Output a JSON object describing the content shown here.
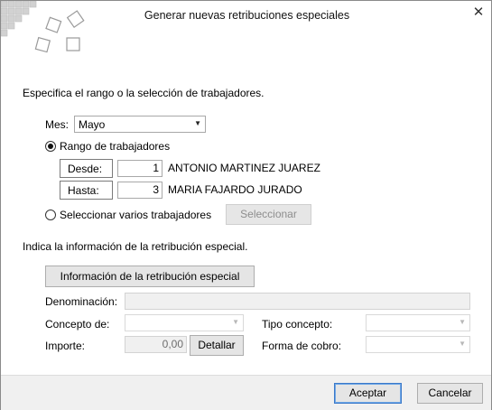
{
  "window": {
    "title": "Generar nuevas retribuciones especiales",
    "close_symbol": "✕"
  },
  "selection": {
    "instruction": "Especifica el rango o la selección de trabajadores.",
    "month_label": "Mes:",
    "month_value": "Mayo",
    "range_option_label": "Rango de trabajadores",
    "from_label": "Desde:",
    "from_value": "1",
    "from_name": "ANTONIO MARTINEZ JUAREZ",
    "to_label": "Hasta:",
    "to_value": "3",
    "to_name": "MARIA FAJARDO JURADO",
    "multi_option_label": "Seleccionar varios trabajadores",
    "select_button": "Seleccionar"
  },
  "retribution": {
    "instruction": "Indica la información de la retribución especial.",
    "info_button": "Información de la retribución especial",
    "denomination_label": "Denominación:",
    "concept_label": "Concepto de:",
    "concept_type_label": "Tipo concepto:",
    "amount_label": "Importe:",
    "amount_value": "0,00",
    "detail_button": "Detallar",
    "payment_label": "Forma de cobro:"
  },
  "footer": {
    "accept": "Aceptar",
    "cancel": "Cancelar"
  },
  "colors": {
    "primary_border": "#3b79c9",
    "logo_gray": "#c8c8c8"
  }
}
